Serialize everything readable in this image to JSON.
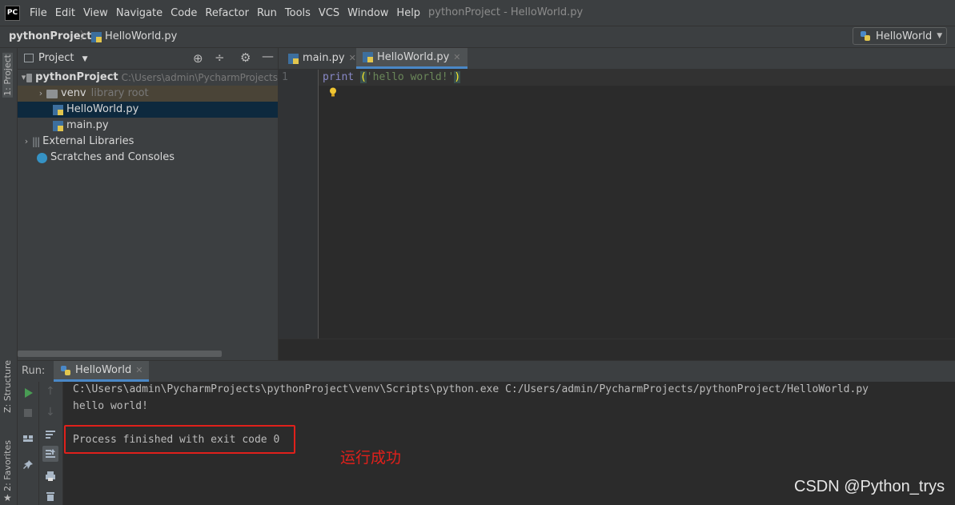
{
  "app": {
    "logo": "PC",
    "window_title": "pythonProject - HelloWorld.py"
  },
  "menu": [
    "File",
    "Edit",
    "View",
    "Navigate",
    "Code",
    "Refactor",
    "Run",
    "Tools",
    "VCS",
    "Window",
    "Help"
  ],
  "breadcrumb": {
    "project": "pythonProject",
    "file": "HelloWorld.py"
  },
  "run_config": "HelloWorld",
  "side_tabs": {
    "project": "1: Project",
    "structure": "Z: Structure",
    "favorites": "2: Favorites"
  },
  "project_panel": {
    "title": "Project",
    "tree": [
      {
        "label": "pythonProject",
        "detail": "C:\\Users\\admin\\PycharmProjects"
      },
      {
        "label": "venv",
        "detail": "library root"
      },
      {
        "label": "HelloWorld.py"
      },
      {
        "label": "main.py"
      },
      {
        "label": "External Libraries"
      },
      {
        "label": "Scratches and Consoles"
      }
    ]
  },
  "editor": {
    "tabs": [
      {
        "label": "main.py"
      },
      {
        "label": "HelloWorld.py"
      }
    ],
    "line_number": "1",
    "code": {
      "keyword": "print",
      "space": " ",
      "open": "(",
      "string": "'hello world!'",
      "close": ")"
    }
  },
  "run_panel": {
    "label": "Run:",
    "tab": "HelloWorld",
    "output": [
      "C:\\Users\\admin\\PycharmProjects\\pythonProject\\venv\\Scripts\\python.exe C:/Users/admin/PycharmProjects/pythonProject/HelloWorld.py",
      "hello world!",
      "Process finished with exit code 0"
    ]
  },
  "annotation": "运行成功",
  "watermark": "CSDN @Python_trys",
  "colors": {
    "accent": "#4a88c7",
    "annotation": "#e0201b",
    "run_green": "#499c54"
  }
}
